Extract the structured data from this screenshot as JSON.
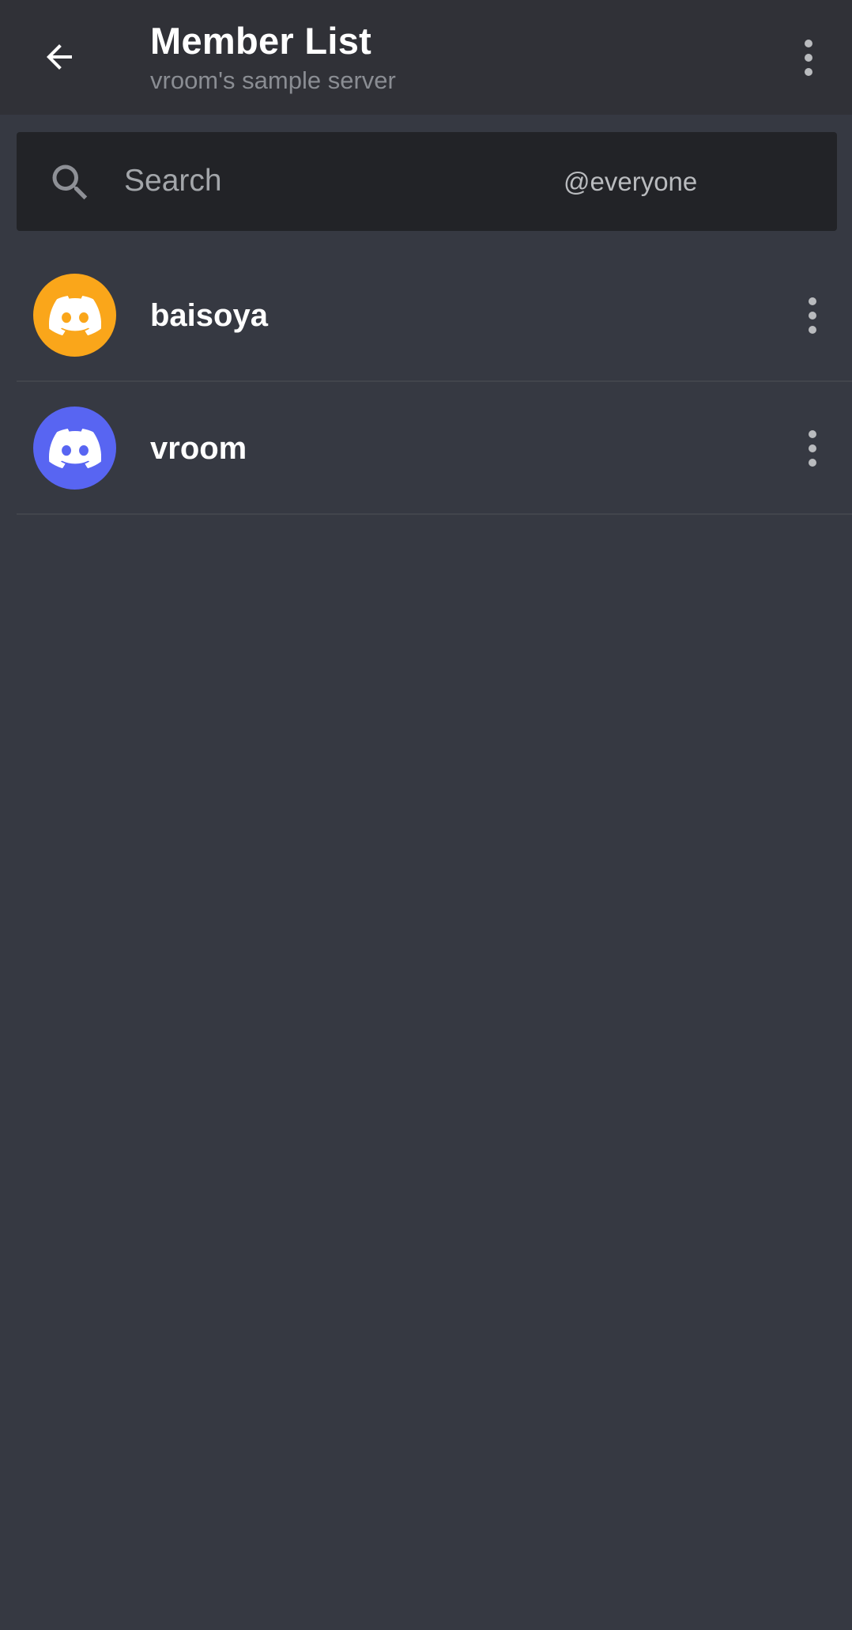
{
  "header": {
    "back_icon": "arrow-left-icon",
    "title": "Member List",
    "subtitle": "vroom's sample server",
    "overflow_icon": "more-vertical-icon"
  },
  "search": {
    "icon": "search-icon",
    "placeholder": "Search",
    "value": "",
    "role_filter": "@everyone"
  },
  "members": [
    {
      "name": "baisoya",
      "avatar_icon": "discord-logo-icon",
      "avatar_color": "#faa61a",
      "menu_icon": "more-vertical-icon"
    },
    {
      "name": "vroom",
      "avatar_icon": "discord-logo-icon",
      "avatar_color": "#5865f2",
      "menu_icon": "more-vertical-icon"
    }
  ],
  "colors": {
    "background": "#363942",
    "app_bar": "#303137",
    "search_bg": "#222327",
    "text_primary": "#ffffff",
    "text_muted": "#8a8d93"
  }
}
